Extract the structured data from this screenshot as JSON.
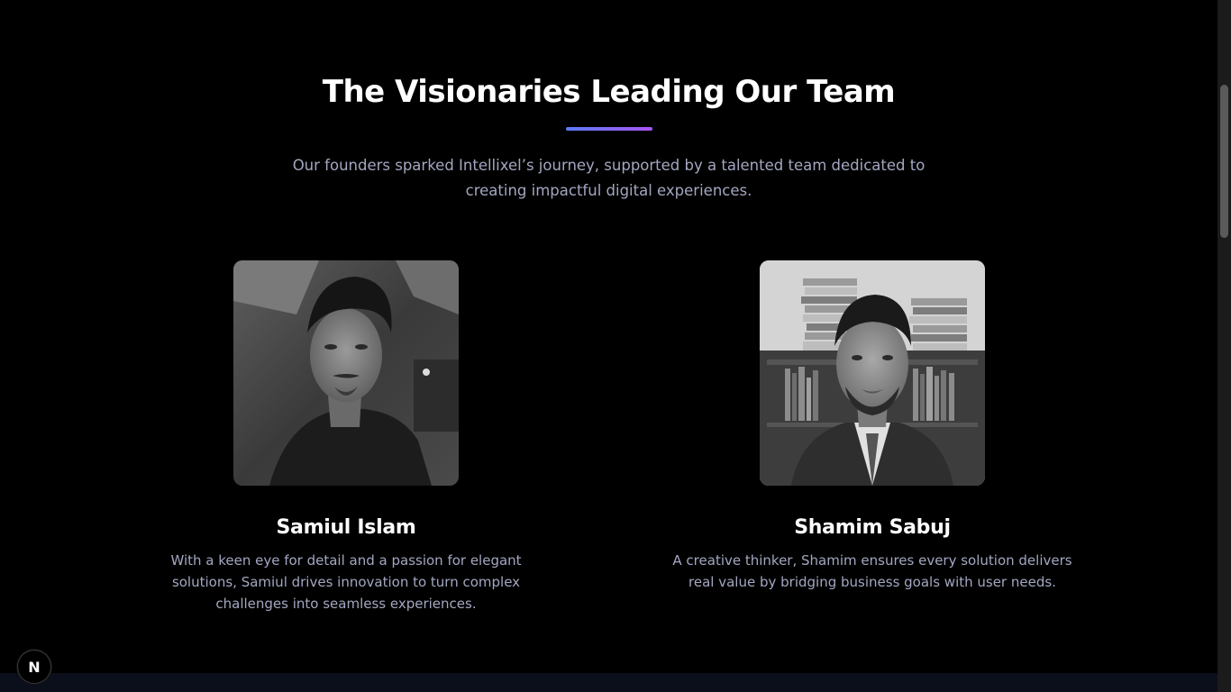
{
  "section": {
    "title": "The Visionaries Leading Our Team",
    "subtitle": "Our founders sparked Intellixel’s journey, supported by a talented team dedicated to creating impactful digital experiences."
  },
  "team": [
    {
      "name": "Samiul Islam",
      "bio": "With a keen eye for detail and a passion for elegant solutions, Samiul drives innovation to turn complex challenges into seamless experiences."
    },
    {
      "name": "Shamim Sabuj",
      "bio": "A creative thinker, Shamim ensures every solution delivers real value by bridging business goals with user needs."
    }
  ],
  "badge": {
    "letter": "N",
    "icon": "nextjs-icon"
  },
  "colors": {
    "background": "#000000",
    "accent_start": "#5b7cfa",
    "accent_end": "#a855f7",
    "muted_text": "#a3a7c0"
  }
}
